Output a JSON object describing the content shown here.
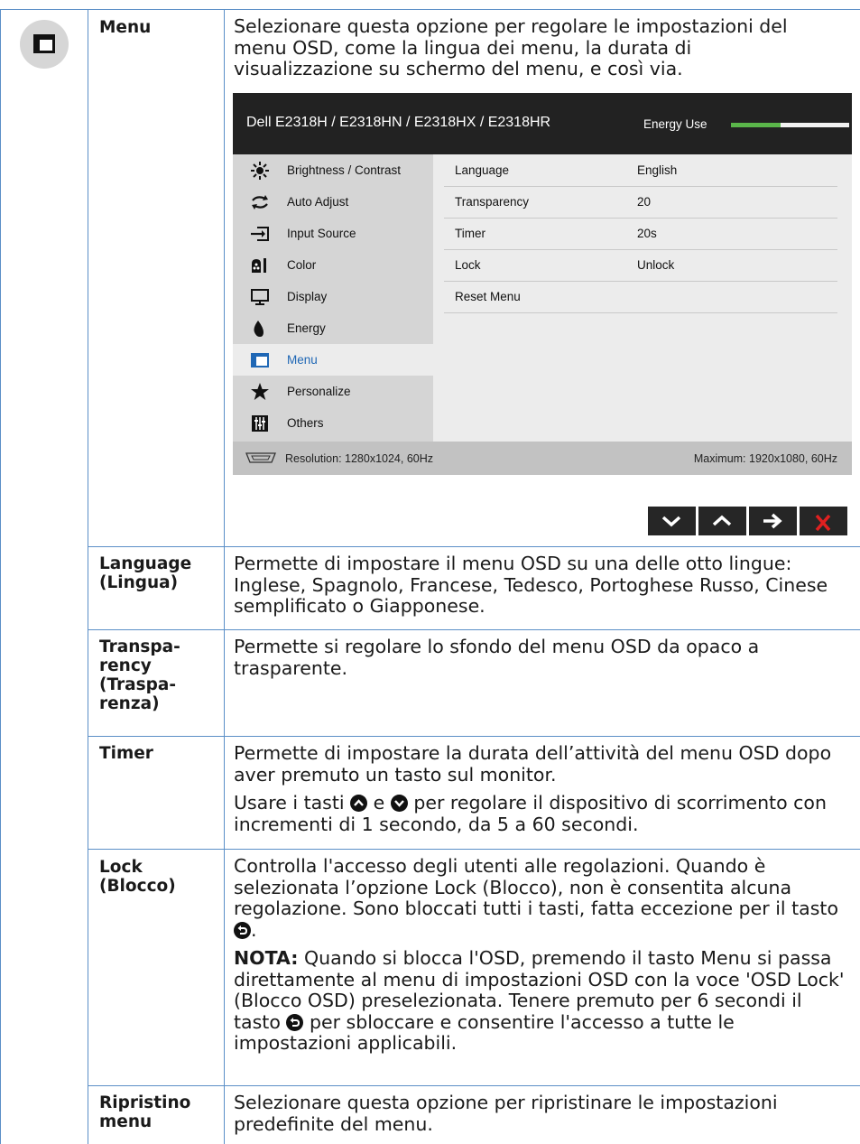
{
  "rows": [
    {
      "label": "Menu",
      "desc": [
        "Selezionare questa opzione per regolare le impostazioni del menu OSD, come la lingua dei menu, la durata di visualizzazione su schermo del menu, e così via."
      ]
    },
    {
      "label": "Language (Lingua)",
      "desc": [
        "Permette di impostare il menu OSD su una delle otto lingue: Inglese, Spagnolo, Francese, Tedesco, Portoghese Russo, Cinese semplificato o Giapponese."
      ]
    },
    {
      "label": "Transpa- rency (Traspa- renza)",
      "desc": [
        "Permette si regolare lo sfondo del menu OSD da opaco a trasparente."
      ]
    },
    {
      "label": "Timer",
      "desc": [
        "Permette di impostare la durata dell’attività del menu OSD dopo aver premuto un tasto sul monitor."
      ],
      "desc2_a": "Usare i tasti",
      "desc2_b": "e",
      "desc2_c": "per regolare il dispositivo di scorrimento con incrementi di 1 secondo, da 5 a 60 secondi."
    },
    {
      "label": "Lock (Blocco)",
      "desc1_a": "Controlla l'accesso degli utenti alle regolazioni. Quando è selezionata l’opzione Lock (Blocco), non è consentita alcuna regolazione. Sono bloccati tutti i tasti, fatta eccezione per il tasto",
      "desc1_b": ".",
      "note_label": "NOTA:",
      "note_a": "Quando si blocca l'OSD, premendo il tasto Menu si passa direttamente al menu di impostazioni OSD con la voce 'OSD Lock' (Blocco OSD) preselezionata. Tenere premuto per 6 secondi il tasto",
      "note_b": "per sbloccare e consentire l'accesso a tutte le impostazioni applicabili."
    },
    {
      "label": "Ripristino menu",
      "desc": [
        "Selezionare questa opzione per ripristinare le impostazioni predefinite del menu."
      ]
    }
  ],
  "osd": {
    "title": "Dell E2318H / E2318HN / E2318HX / E2318HR",
    "energy_label": "Energy Use",
    "energy_level": 0.42,
    "menu_items": [
      {
        "label": "Brightness / Contrast",
        "icon": "brightness-icon"
      },
      {
        "label": "Auto Adjust",
        "icon": "auto-adjust-icon"
      },
      {
        "label": "Input Source",
        "icon": "input-source-icon"
      },
      {
        "label": "Color",
        "icon": "color-icon"
      },
      {
        "label": "Display",
        "icon": "display-icon"
      },
      {
        "label": "Energy",
        "icon": "energy-icon"
      },
      {
        "label": "Menu",
        "icon": "menu-icon",
        "selected": true
      },
      {
        "label": "Personalize",
        "icon": "star-icon"
      },
      {
        "label": "Others",
        "icon": "others-icon"
      }
    ],
    "settings": [
      {
        "key": "Language",
        "value": "English"
      },
      {
        "key": "Transparency",
        "value": "20"
      },
      {
        "key": "Timer",
        "value": "20s"
      },
      {
        "key": "Lock",
        "value": "Unlock"
      },
      {
        "key": "Reset Menu",
        "value": ""
      }
    ],
    "resolution": "Resolution: 1280x1024, 60Hz",
    "maximum": "Maximum: 1920x1080, 60Hz"
  },
  "colors": {
    "border": "#5b8fc7",
    "energy_green": "#5ab64a",
    "selected_blue": "#1f67b5",
    "close_red": "#e02020"
  },
  "nav_buttons": [
    "down-icon",
    "up-icon",
    "right-arrow-icon",
    "close-icon"
  ]
}
